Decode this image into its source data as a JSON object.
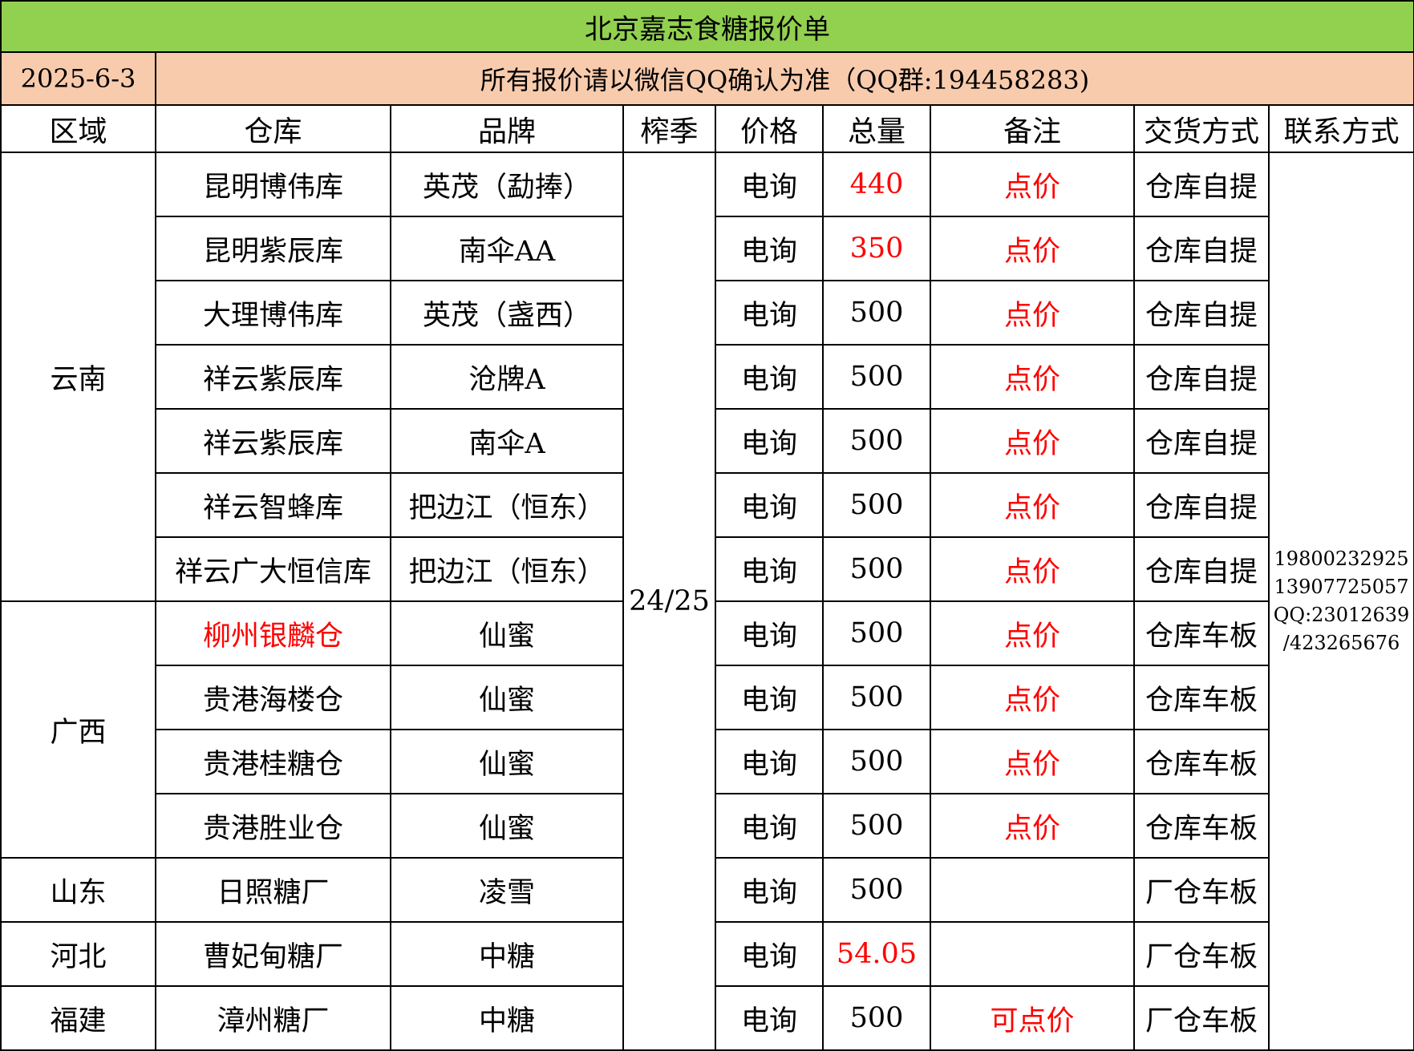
{
  "title": "北京嘉志食糖报价单",
  "date": "2025-6-3",
  "notice": "所有报价请以微信QQ确认为准（QQ群:194458283)",
  "headers": {
    "region": "区域",
    "warehouse": "仓库",
    "brand": "品牌",
    "season": "榨季",
    "price": "价格",
    "total": "总量",
    "remark": "备注",
    "delivery": "交货方式",
    "contact": "联系方式"
  },
  "season": "24/25",
  "contact": [
    "19800232925",
    "13907725057",
    "QQ:23012639",
    "/423265676"
  ],
  "regions": [
    "云南",
    "广西",
    "山东",
    "河北",
    "福建"
  ],
  "rows": [
    {
      "warehouse": "昆明博伟库",
      "brand": "英茂（勐捧）",
      "price": "电询",
      "total": "440",
      "remark": "点价",
      "delivery": "仓库自提"
    },
    {
      "warehouse": "昆明紫辰库",
      "brand": "南伞AA",
      "price": "电询",
      "total": "350",
      "remark": "点价",
      "delivery": "仓库自提"
    },
    {
      "warehouse": "大理博伟库",
      "brand": "英茂（盏西）",
      "price": "电询",
      "total": "500",
      "remark": "点价",
      "delivery": "仓库自提"
    },
    {
      "warehouse": "祥云紫辰库",
      "brand": "沧牌A",
      "price": "电询",
      "total": "500",
      "remark": "点价",
      "delivery": "仓库自提"
    },
    {
      "warehouse": "祥云紫辰库",
      "brand": "南伞A",
      "price": "电询",
      "total": "500",
      "remark": "点价",
      "delivery": "仓库自提"
    },
    {
      "warehouse": "祥云智蜂库",
      "brand": "把边江（恒东）",
      "price": "电询",
      "total": "500",
      "remark": "点价",
      "delivery": "仓库自提"
    },
    {
      "warehouse": "祥云广大恒信库",
      "brand": "把边江（恒东）",
      "price": "电询",
      "total": "500",
      "remark": "点价",
      "delivery": "仓库自提"
    },
    {
      "warehouse": "柳州银麟仓",
      "brand": "仙蜜",
      "price": "电询",
      "total": "500",
      "remark": "点价",
      "delivery": "仓库车板"
    },
    {
      "warehouse": "贵港海楼仓",
      "brand": "仙蜜",
      "price": "电询",
      "total": "500",
      "remark": "点价",
      "delivery": "仓库车板"
    },
    {
      "warehouse": "贵港桂糖仓",
      "brand": "仙蜜",
      "price": "电询",
      "total": "500",
      "remark": "点价",
      "delivery": "仓库车板"
    },
    {
      "warehouse": "贵港胜业仓",
      "brand": "仙蜜",
      "price": "电询",
      "total": "500",
      "remark": "点价",
      "delivery": "仓库车板"
    },
    {
      "warehouse": "日照糖厂",
      "brand": "凌雪",
      "price": "电询",
      "total": "500",
      "remark": "",
      "delivery": "厂仓车板"
    },
    {
      "warehouse": "曹妃甸糖厂",
      "brand": "中糖",
      "price": "电询",
      "total": "54.05",
      "remark": "",
      "delivery": "厂仓车板"
    },
    {
      "warehouse": "漳州糖厂",
      "brand": "中糖",
      "price": "电询",
      "total": "500",
      "remark": "可点价",
      "delivery": "厂仓车板"
    }
  ],
  "colors": {
    "title_bg": "#92d050",
    "info_bg": "#f8cbad",
    "highlight": "#ff0000"
  }
}
